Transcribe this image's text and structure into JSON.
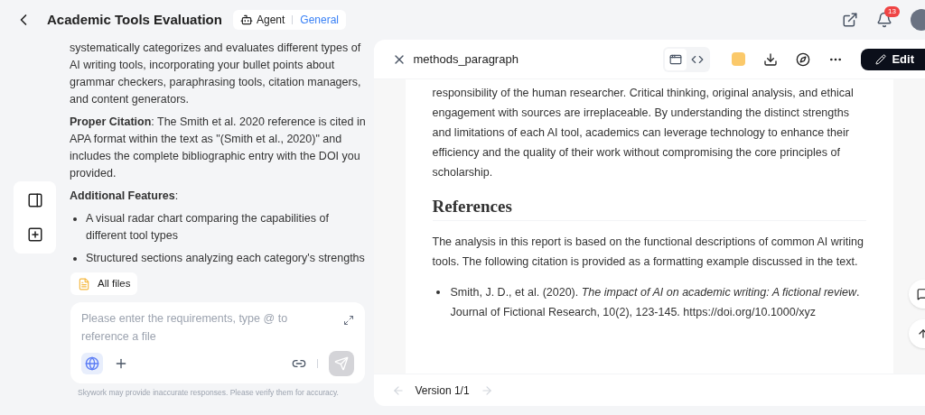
{
  "header": {
    "title": "Academic Tools Evaluation",
    "mode": "Agent",
    "mode_value": "General",
    "notification_count": "13"
  },
  "chat": {
    "paragraphs": [
      {
        "kind": "text",
        "text": "systematically categorizes and evaluates different types of AI writing tools, incorporating your bullet points about grammar checkers, paraphrasing tools, citation managers, and content generators."
      },
      {
        "kind": "text",
        "text": "**Proper Citation**: The Smith et al. 2020 reference is cited in APA format within the text as \"(Smith et al., 2020)\" and includes the complete bibliographic entry with the DOI you provided."
      },
      {
        "kind": "text",
        "text": "**Additional Features**:"
      },
      {
        "kind": "bullet",
        "text": "A visual radar chart comparing the capabilities of different tool types"
      },
      {
        "kind": "bullet",
        "text": "Structured sections analyzing each category's strengths"
      }
    ],
    "files_chip": "All files",
    "input": {
      "placeholder": "Please enter the requirements, type @ to reference a file"
    },
    "web_search_on": true,
    "disclaimer": "Skywork may provide inaccurate responses. Please verify them for accuracy."
  },
  "panel": {
    "title": "methods_paragraph",
    "views": [
      {
        "kind": "preview",
        "selected": true
      },
      {
        "kind": "code",
        "selected": false
      }
    ],
    "edit_button": "Edit",
    "document": {
      "paragraph": "responsibility of the human researcher. Critical thinking, original analysis, and ethical engagement with sources are irreplaceable. By understanding the distinct strengths and limitations of each AI tool, academics can leverage technology to enhance their efficiency and the quality of their work without compromising the core principles of scholarship.",
      "heading": "References",
      "intro": "The analysis in this report is based on the functional descriptions of common AI writing tools. The following citation is provided as a formatting example discussed in the text.",
      "references": [
        "Smith, J. D., et al. (2020). *The impact of AI on academic writing: A fictional review*. Journal of Fictional Research, 10(2), 123-145. https://doi.org/10.1000/xyz"
      ]
    },
    "version": "Version 1/1"
  }
}
